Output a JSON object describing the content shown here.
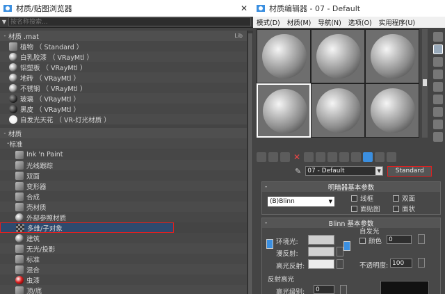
{
  "left_window": {
    "title": "材质/贴图浏览器",
    "close": "✕",
    "search_placeholder": "按名称搜索...",
    "section1": {
      "label": "材质 .mat",
      "badge": "Lib"
    },
    "mat_items": [
      {
        "label": "植物 （ Standard ）",
        "thumb": "sq"
      },
      {
        "label": "白乳胶漆 （ VRayMtl ）",
        "thumb": "sph"
      },
      {
        "label": "铝塑板 （ VRayMtl ）",
        "thumb": "sph"
      },
      {
        "label": "地砖 （ VRayMtl ）",
        "thumb": "sph"
      },
      {
        "label": "不锈钢 （ VRayMtl ）",
        "thumb": "sph"
      },
      {
        "label": "玻璃 （ VRayMtl ）",
        "thumb": "sph dark"
      },
      {
        "label": "黑皮 （ VRayMtl ）",
        "thumb": "sph dark"
      },
      {
        "label": "自发光天花 （ VR-灯光材质 ）",
        "thumb": "sph glow"
      }
    ],
    "section2": {
      "label": "材质"
    },
    "subgroup": {
      "label": "标准"
    },
    "std_items": [
      {
        "label": "Ink 'n Paint",
        "thumb": "sq"
      },
      {
        "label": "光线跟踪",
        "thumb": "sq"
      },
      {
        "label": "双面",
        "thumb": "sq"
      },
      {
        "label": "变形器",
        "thumb": "sq"
      },
      {
        "label": "合成",
        "thumb": "sq"
      },
      {
        "label": "壳材质",
        "thumb": "sq"
      },
      {
        "label": "外部参照材质",
        "thumb": "sph"
      },
      {
        "label": "多维/子对象",
        "thumb": "sq checker",
        "selected": true
      },
      {
        "label": "建筑",
        "thumb": "sph"
      },
      {
        "label": "无光/投影",
        "thumb": "sq"
      },
      {
        "label": "标准",
        "thumb": "sq"
      },
      {
        "label": "混合",
        "thumb": "sq"
      },
      {
        "label": "虫漆",
        "thumb": "sph red"
      },
      {
        "label": "顶/底",
        "thumb": "sq"
      }
    ]
  },
  "right_window": {
    "title": "材质编辑器 - 07 - Default",
    "menus": [
      "模式(D)",
      "材质(M)",
      "导航(N)",
      "选项(O)",
      "实用程序(U)"
    ],
    "material_name": "07 - Default",
    "material_type": "Standard",
    "panel_shader": {
      "title": "明暗器基本参数",
      "shader": "(B)Blinn",
      "checks": [
        "线框",
        "双面",
        "面贴图",
        "面状"
      ]
    },
    "panel_blinn": {
      "title": "Blinn 基本参数",
      "ambient": "环境光:",
      "diffuse": "漫反射:",
      "specular": "高光反射:",
      "self_illum": "自发光",
      "color_label": "颜色",
      "color_value": "0",
      "opacity_label": "不透明度:",
      "opacity_value": "100",
      "spec_section": "反射高光",
      "spec_level": "高光级别:",
      "spec_level_value": "0"
    }
  }
}
